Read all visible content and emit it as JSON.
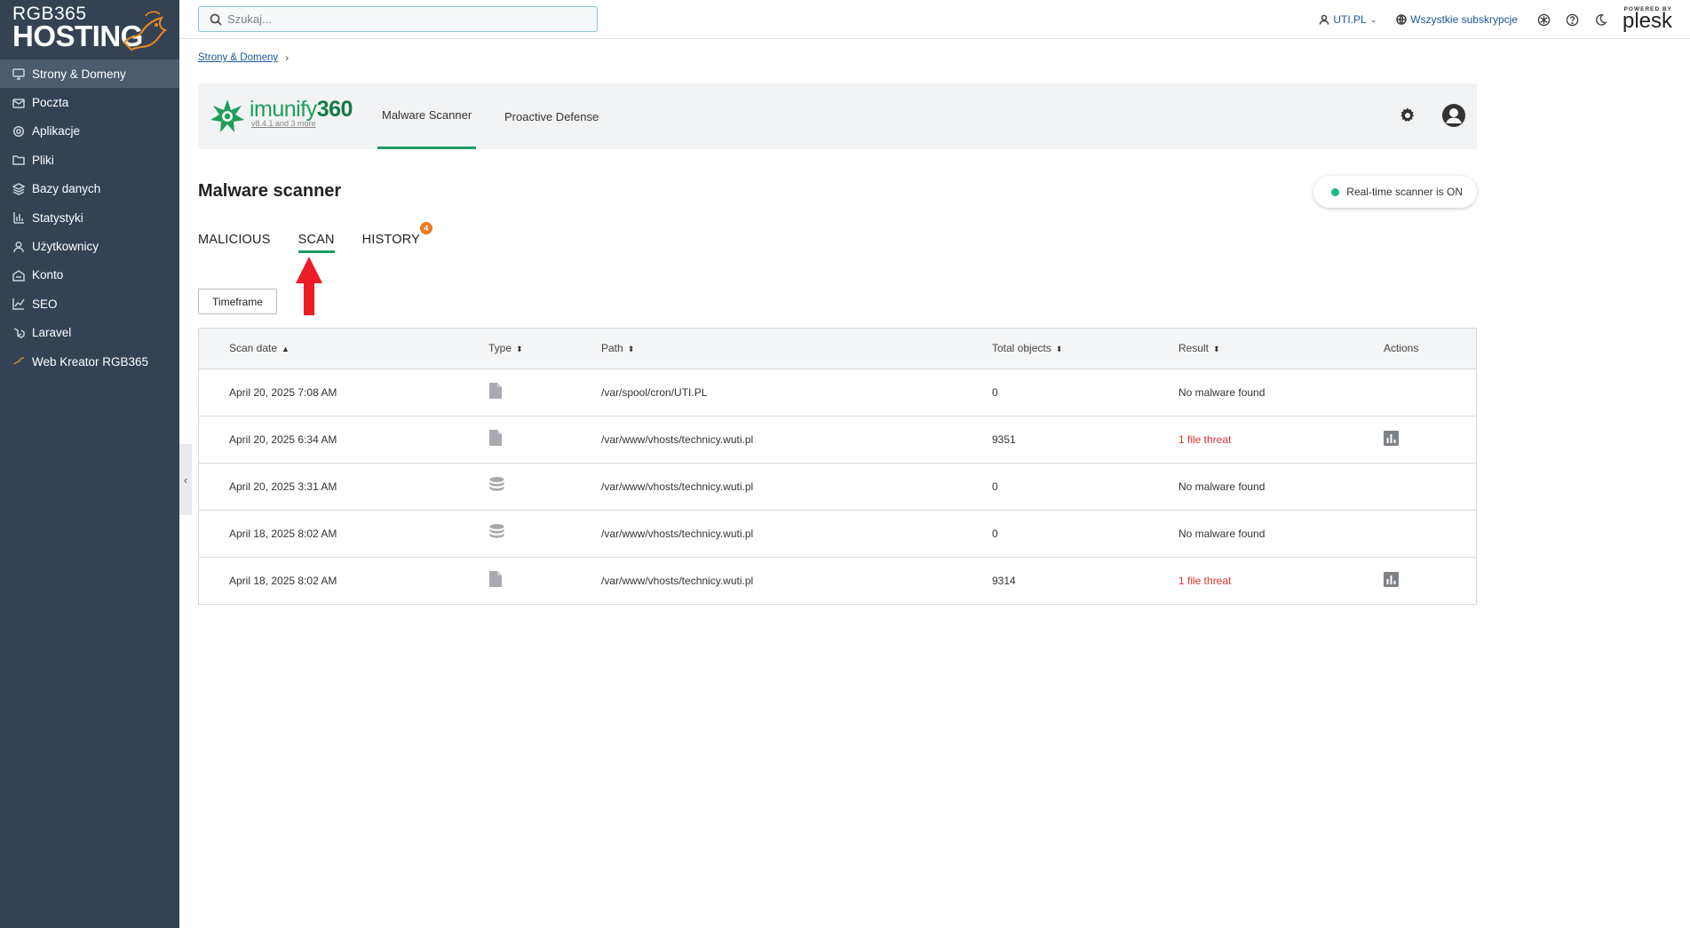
{
  "sidebar": {
    "logo_line1": "RGB365",
    "logo_line2": "HOSTING",
    "items": [
      {
        "label": "Strony & Domeny",
        "icon": "monitor-icon",
        "active": true
      },
      {
        "label": "Poczta",
        "icon": "mail-icon"
      },
      {
        "label": "Aplikacje",
        "icon": "gear-icon"
      },
      {
        "label": "Pliki",
        "icon": "folder-icon"
      },
      {
        "label": "Bazy danych",
        "icon": "database-icon"
      },
      {
        "label": "Statystyki",
        "icon": "bar-chart-icon"
      },
      {
        "label": "Użytkownicy",
        "icon": "user-icon"
      },
      {
        "label": "Konto",
        "icon": "account-icon"
      },
      {
        "label": "SEO",
        "icon": "trend-icon"
      },
      {
        "label": "Laravel",
        "icon": "laravel-icon"
      },
      {
        "label": "Web Kreator RGB365",
        "icon": "webkreator-icon"
      }
    ]
  },
  "topbar": {
    "search_placeholder": "Szukaj...",
    "user": "UTI.PL",
    "subscriptions": "Wszystkie subskrypcje",
    "powered_by": "POWERED BY",
    "plesk": "plesk"
  },
  "breadcrumb": {
    "item": "Strony & Domeny"
  },
  "extension": {
    "brand_prefix": "imunify",
    "brand_suffix": "360",
    "version": "v8.4.1 and 3 more",
    "tabs": [
      "Malware Scanner",
      "Proactive Defense"
    ]
  },
  "page": {
    "title": "Malware scanner",
    "realtime": "Real-time scanner is ON",
    "tabs": {
      "malicious": "MALICIOUS",
      "scan": "SCAN",
      "history": "HISTORY",
      "history_count": "4"
    },
    "timeframe": "Timeframe"
  },
  "table": {
    "headers": {
      "date": "Scan date",
      "type": "Type",
      "path": "Path",
      "total": "Total objects",
      "result": "Result",
      "actions": "Actions"
    },
    "rows": [
      {
        "date": "April 20, 2025 7:08 AM",
        "type": "file-icon",
        "path": "/var/spool/cron/UTI.PL",
        "total": "0",
        "result": "No malware found",
        "threat": false
      },
      {
        "date": "April 20, 2025 6:34 AM",
        "type": "file-icon",
        "path": "/var/www/vhosts/technicy.wuti.pl",
        "total": "9351",
        "result": "1 file threat",
        "threat": true
      },
      {
        "date": "April 20, 2025 3:31 AM",
        "type": "database-icon",
        "path": "/var/www/vhosts/technicy.wuti.pl",
        "total": "0",
        "result": "No malware found",
        "threat": false
      },
      {
        "date": "April 18, 2025 8:02 AM",
        "type": "database-icon",
        "path": "/var/www/vhosts/technicy.wuti.pl",
        "total": "0",
        "result": "No malware found",
        "threat": false
      },
      {
        "date": "April 18, 2025 8:02 AM",
        "type": "file-icon",
        "path": "/var/www/vhosts/technicy.wuti.pl",
        "total": "9314",
        "result": "1 file threat",
        "threat": true
      }
    ]
  },
  "colors": {
    "sidebar_bg": "#354254",
    "accent_green": "#1d9d68",
    "threat_red": "#e0342c",
    "badge_orange": "#f07b1d"
  }
}
